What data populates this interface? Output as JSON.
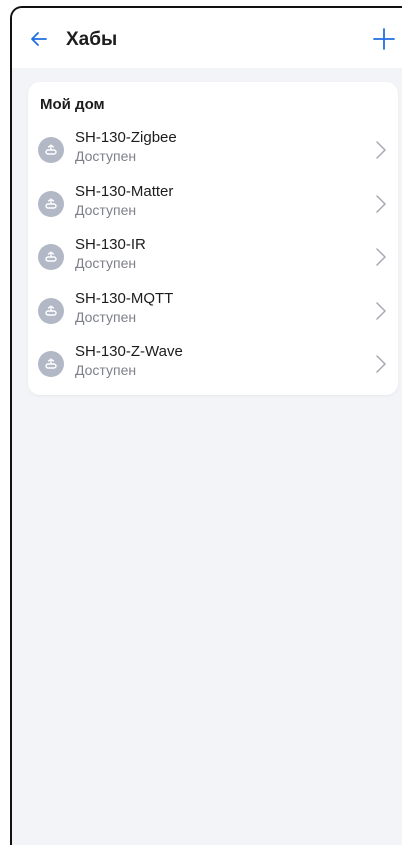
{
  "header": {
    "title": "Хабы",
    "back_icon": "arrow-left-icon",
    "add_icon": "plus-icon"
  },
  "colors": {
    "accent": "#1f6fe0",
    "background": "#f3f4f7",
    "card": "#ffffff",
    "icon_bg": "#b3b8c6",
    "secondary_text": "#7d8089"
  },
  "group": {
    "title": "Мой дом",
    "hubs": [
      {
        "name": "SH-130-Zigbee",
        "status": "Доступен",
        "icon": "hub-icon"
      },
      {
        "name": "SH-130-Matter",
        "status": "Доступен",
        "icon": "hub-icon"
      },
      {
        "name": "SH-130-IR",
        "status": "Доступен",
        "icon": "hub-icon"
      },
      {
        "name": "SH-130-MQTT",
        "status": "Доступен",
        "icon": "hub-icon"
      },
      {
        "name": "SH-130-Z-Wave",
        "status": "Доступен",
        "icon": "hub-icon"
      }
    ]
  }
}
